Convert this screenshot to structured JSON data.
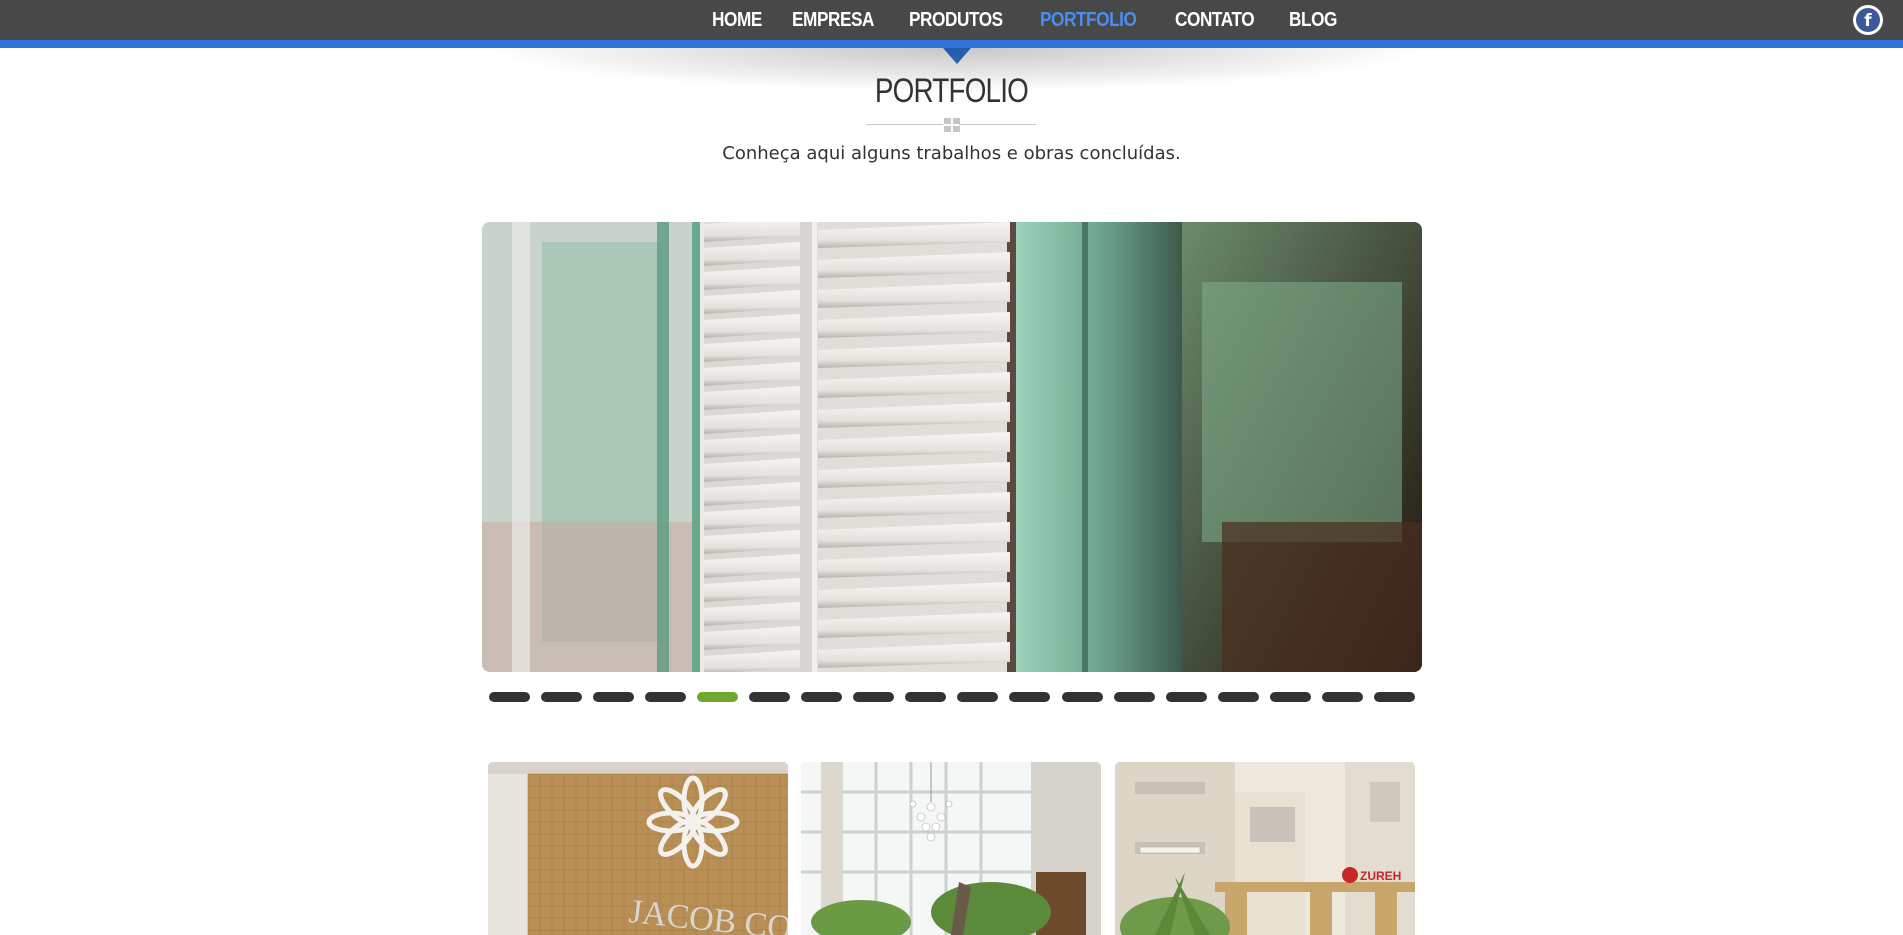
{
  "nav": {
    "items": [
      {
        "label": "HOME"
      },
      {
        "label": "EMPRESA"
      },
      {
        "label": "PRODUTOS"
      },
      {
        "label": "PORTFOLIO"
      },
      {
        "label": "CONTATO"
      },
      {
        "label": "BLOG"
      }
    ],
    "active_label": "PORTFOLIO",
    "social_icon": "facebook-icon",
    "social_glyph": "f"
  },
  "colors": {
    "nav_bg": "#484848",
    "accent_blue": "#2f74d8",
    "active_link": "#4a8ef0",
    "dot_active": "#6ea82c",
    "dot_inactive": "#333333"
  },
  "section": {
    "title": "PORTFOLIO",
    "subtitle": "Conheça aqui alguns trabalhos e obras concluídas."
  },
  "slider": {
    "image": "white-louvered-shutter-photo",
    "dot_count": 18,
    "active_dot": 5
  },
  "thumbnails": [
    {
      "image": "building-facade-flower-logo-photo",
      "sign_text": "JACOB CO"
    },
    {
      "image": "glass-lobby-chandelier-photo"
    },
    {
      "image": "residential-building-exterior-photo",
      "sign_text": "ZUREH"
    }
  ]
}
